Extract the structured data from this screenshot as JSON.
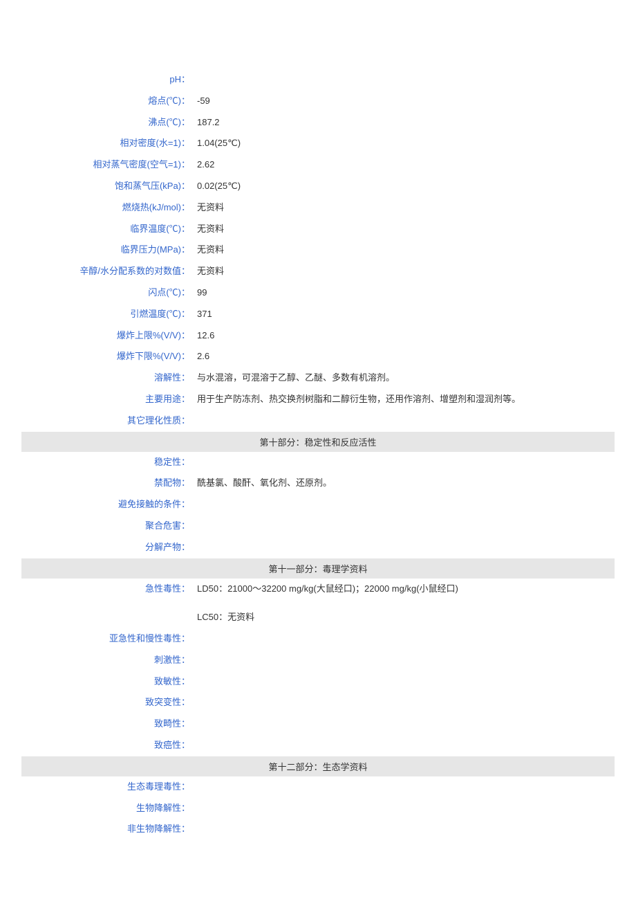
{
  "section9": {
    "rows": [
      {
        "label": "pH：",
        "value": ""
      },
      {
        "label": "熔点(℃)：",
        "value": "-59"
      },
      {
        "label": "沸点(℃)：",
        "value": "187.2"
      },
      {
        "label": "相对密度(水=1)：",
        "value": "1.04(25℃)"
      },
      {
        "label": "相对蒸气密度(空气=1)：",
        "value": "2.62"
      },
      {
        "label": "饱和蒸气压(kPa)：",
        "value": "0.02(25℃)"
      },
      {
        "label": "燃烧热(kJ/mol)：",
        "value": "无资料"
      },
      {
        "label": "临界温度(℃)：",
        "value": "无资料"
      },
      {
        "label": "临界压力(MPa)：",
        "value": "无资料"
      },
      {
        "label": "辛醇/水分配系数的对数值：",
        "value": "无资料"
      },
      {
        "label": "闪点(℃)：",
        "value": "99"
      },
      {
        "label": "引燃温度(℃)：",
        "value": "371"
      },
      {
        "label": "爆炸上限%(V/V)：",
        "value": "12.6"
      },
      {
        "label": "爆炸下限%(V/V)：",
        "value": "2.6"
      },
      {
        "label": "溶解性：",
        "value": "与水混溶，可混溶于乙醇、乙醚、多数有机溶剂。"
      },
      {
        "label": "主要用途：",
        "value": "用于生产防冻剂、热交换剂树脂和二醇衍生物，还用作溶剂、增塑剂和湿润剂等。"
      },
      {
        "label": "其它理化性质：",
        "value": ""
      }
    ]
  },
  "section10": {
    "title": "第十部分：稳定性和反应活性",
    "rows": [
      {
        "label": "稳定性：",
        "value": ""
      },
      {
        "label": "禁配物：",
        "value": "酰基氯、酸酐、氧化剂、还原剂。"
      },
      {
        "label": "避免接触的条件：",
        "value": ""
      },
      {
        "label": "聚合危害：",
        "value": ""
      },
      {
        "label": "分解产物：",
        "value": ""
      }
    ]
  },
  "section11": {
    "title": "第十一部分：毒理学资料",
    "rows": [
      {
        "label": "急性毒性：",
        "value": "LD50：21000～32200 mg/kg(大鼠经口)；22000 mg/kg(小鼠经口)\n\nLC50：无资料"
      },
      {
        "label": "亚急性和慢性毒性：",
        "value": ""
      },
      {
        "label": "刺激性：",
        "value": ""
      },
      {
        "label": "致敏性：",
        "value": ""
      },
      {
        "label": "致突变性：",
        "value": ""
      },
      {
        "label": "致畸性：",
        "value": ""
      },
      {
        "label": "致癌性：",
        "value": ""
      }
    ]
  },
  "section12": {
    "title": "第十二部分：生态学资料",
    "rows": [
      {
        "label": "生态毒理毒性：",
        "value": ""
      },
      {
        "label": "生物降解性：",
        "value": ""
      },
      {
        "label": "非生物降解性：",
        "value": ""
      }
    ]
  }
}
